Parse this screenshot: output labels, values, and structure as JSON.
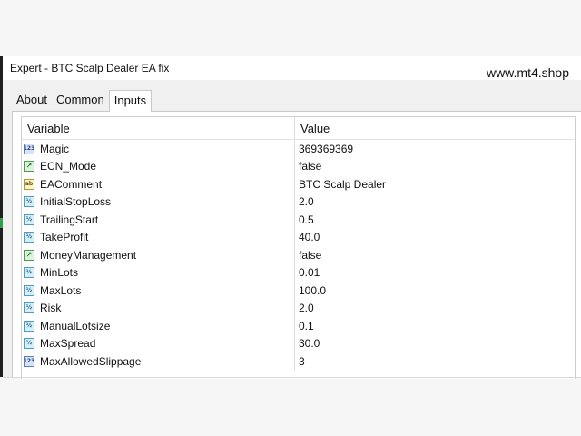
{
  "window": {
    "title": "Expert - BTC Scalp Dealer EA fix",
    "watermark": "www.mt4.shop"
  },
  "tabs": [
    {
      "label": "About",
      "active": false
    },
    {
      "label": "Common",
      "active": false
    },
    {
      "label": "Inputs",
      "active": true
    }
  ],
  "table": {
    "columns": [
      "Variable",
      "Value"
    ],
    "rows": [
      {
        "icon": "int-icon",
        "variable": "Magic",
        "value": "369369369"
      },
      {
        "icon": "bool-icon",
        "variable": "ECN_Mode",
        "value": "false"
      },
      {
        "icon": "string-icon",
        "variable": "EAComment",
        "value": "BTC Scalp Dealer"
      },
      {
        "icon": "double-icon",
        "variable": "InitialStopLoss",
        "value": "2.0"
      },
      {
        "icon": "double-icon",
        "variable": "TrailingStart",
        "value": "0.5"
      },
      {
        "icon": "double-icon",
        "variable": "TakeProfit",
        "value": "40.0"
      },
      {
        "icon": "bool-icon",
        "variable": "MoneyManagement",
        "value": "false"
      },
      {
        "icon": "double-icon",
        "variable": "MinLots",
        "value": "0.01"
      },
      {
        "icon": "double-icon",
        "variable": "MaxLots",
        "value": "100.0"
      },
      {
        "icon": "double-icon",
        "variable": "Risk",
        "value": "2.0"
      },
      {
        "icon": "double-icon",
        "variable": "ManualLotsize",
        "value": "0.1"
      },
      {
        "icon": "double-icon",
        "variable": "MaxSpread",
        "value": "30.0"
      },
      {
        "icon": "int-icon",
        "variable": "MaxAllowedSlippage",
        "value": "3"
      }
    ]
  },
  "icon_glyphs": {
    "int-icon": "123",
    "bool-icon": "↗",
    "string-icon": "ab",
    "double-icon": "½"
  },
  "colors": {
    "panel_border": "#c9c9c9",
    "left_strip": "#1f1f1f",
    "left_strip_mark": "#2ea043"
  }
}
